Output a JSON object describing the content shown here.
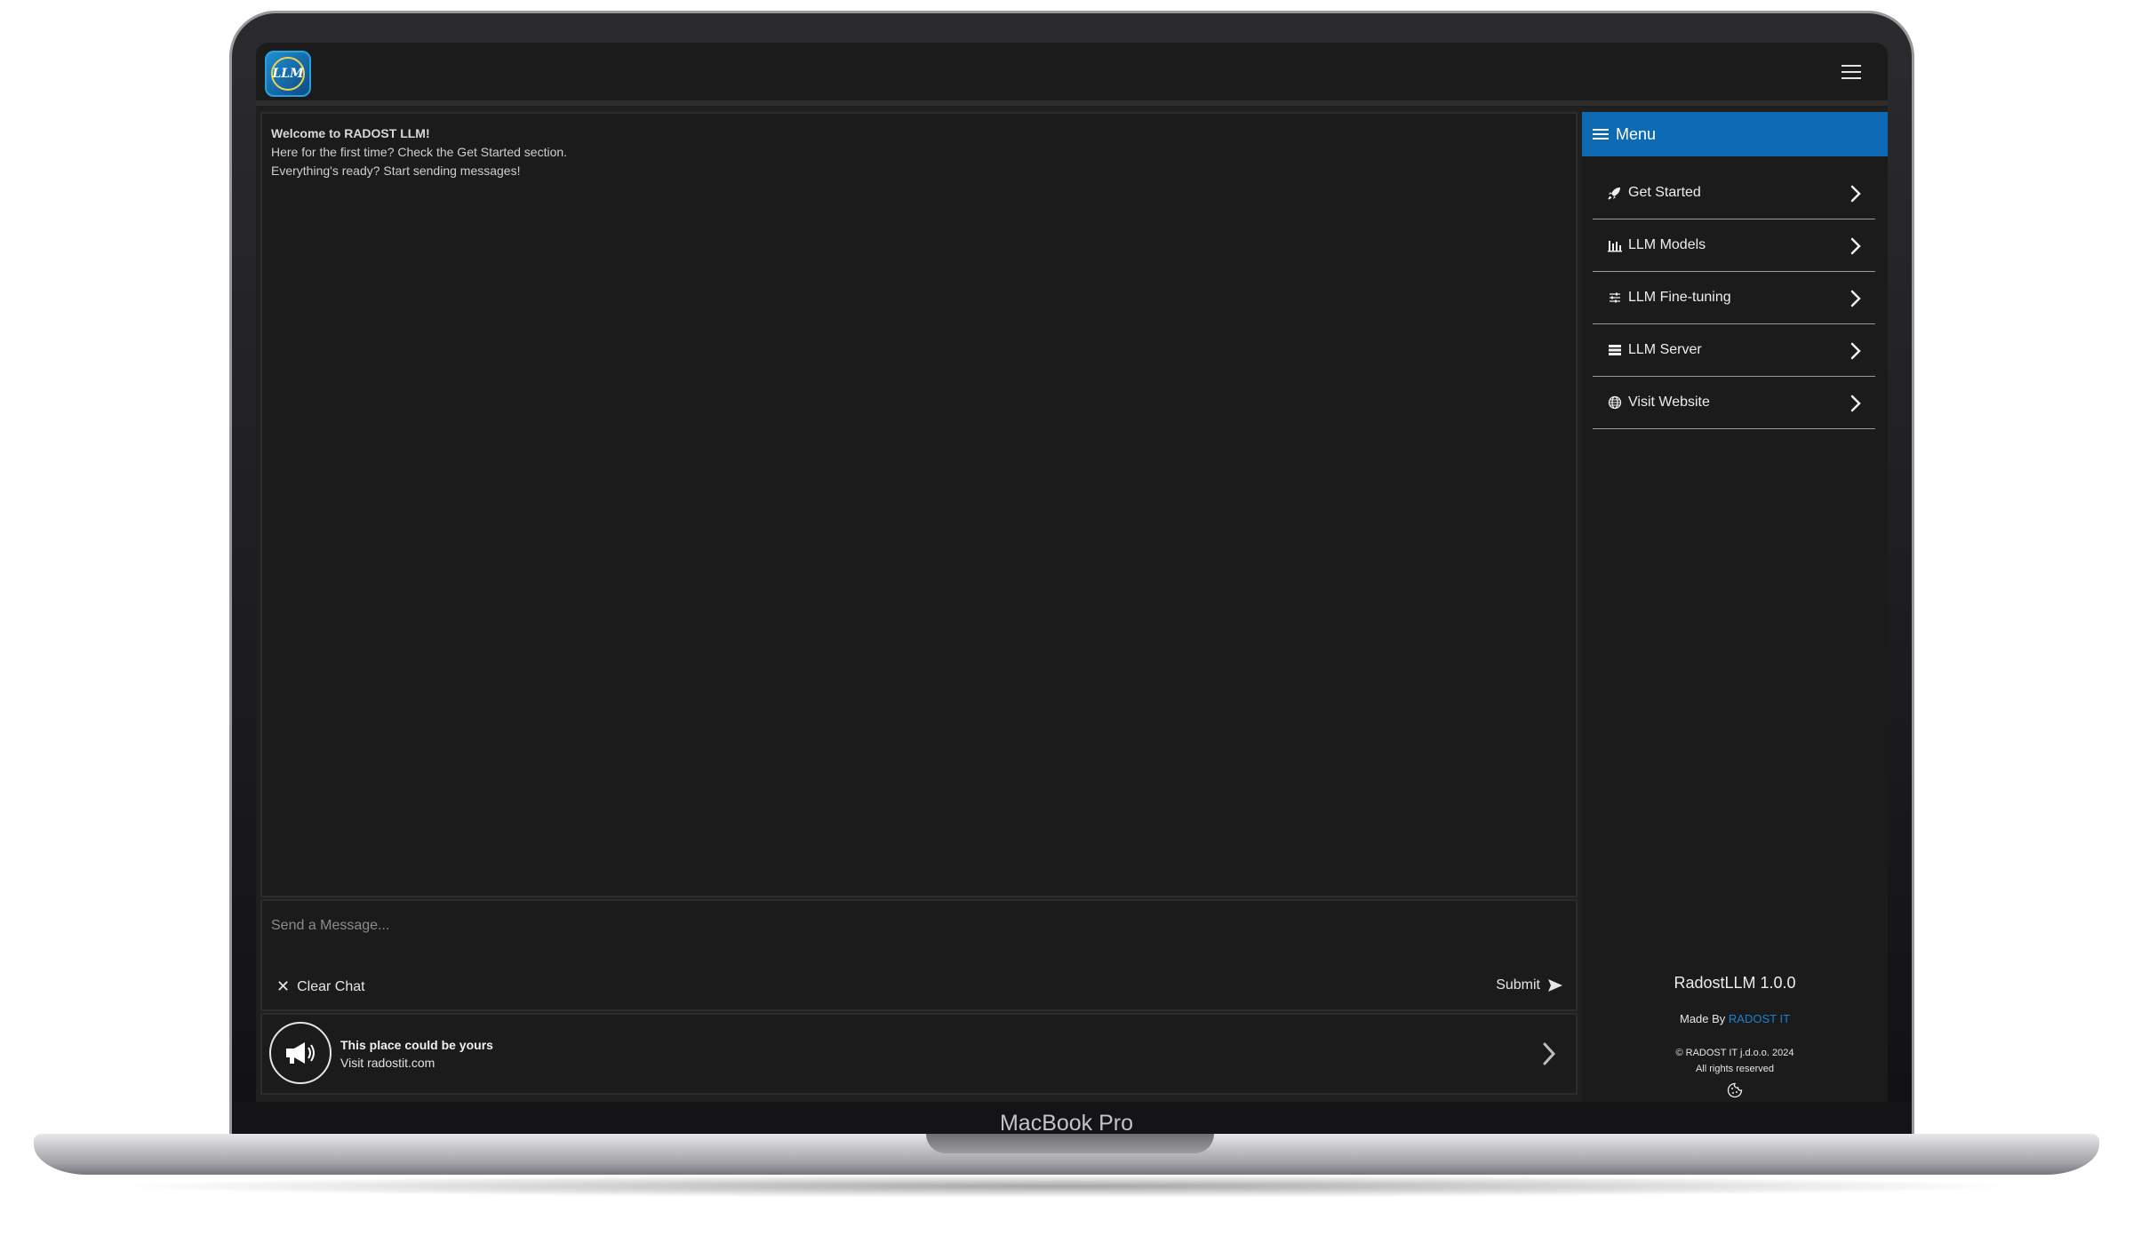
{
  "device": {
    "model_label": "MacBook Pro"
  },
  "header": {
    "logo_text": "LLM"
  },
  "chat": {
    "welcome_title": "Welcome to RADOST LLM!",
    "welcome_line1": "Here for the first time? Check the Get Started section.",
    "welcome_line2": "Everything's ready? Start sending messages!"
  },
  "composer": {
    "placeholder": "Send a Message...",
    "clear_label": "Clear Chat",
    "submit_label": "Submit"
  },
  "ad": {
    "title": "This place could be yours",
    "subtitle": "Visit radostit.com"
  },
  "menu": {
    "title": "Menu",
    "items": [
      {
        "label": "Get Started",
        "icon": "rocket-icon"
      },
      {
        "label": "LLM Models",
        "icon": "bar-chart-icon"
      },
      {
        "label": "LLM Fine-tuning",
        "icon": "sliders-icon"
      },
      {
        "label": "LLM Server",
        "icon": "server-icon"
      },
      {
        "label": "Visit Website",
        "icon": "globe-icon"
      }
    ]
  },
  "footer": {
    "version": "RadostLLM 1.0.0",
    "made_by_prefix": "Made By ",
    "made_by_link": "RADOST IT",
    "copyright": "© RADOST IT j.d.o.o. 2024",
    "rights": "All rights reserved"
  },
  "colors": {
    "accent": "#0d6ab5",
    "link": "#1a82cf",
    "background": "#1b1b1b"
  }
}
